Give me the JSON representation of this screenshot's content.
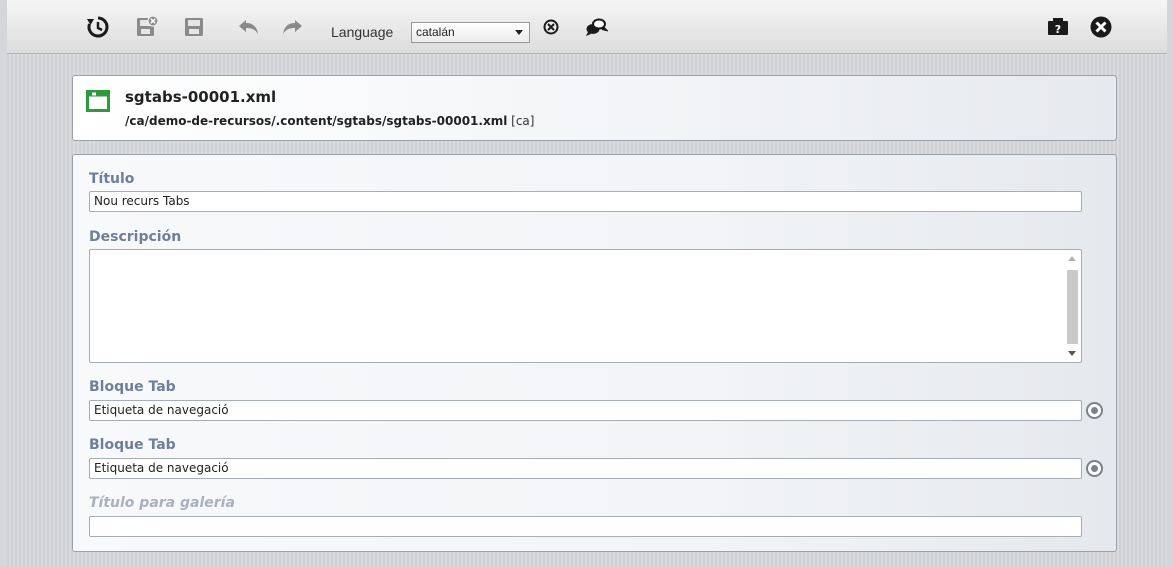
{
  "toolbar": {
    "icons": {
      "history": "history-icon",
      "save_exit": "save-exit-icon",
      "save": "save-icon",
      "undo": "undo-icon",
      "redo": "redo-icon",
      "delete_locale": "delete-locale-icon",
      "compare_locales": "compare-locales-icon",
      "help": "help-icon",
      "close": "close-icon"
    },
    "language_label": "Language",
    "language_value": "catalán"
  },
  "header": {
    "title": "sgtabs-00001.xml",
    "path": "/ca/demo-de-recursos/.content/sgtabs/sgtabs-00001.xml",
    "locale": "[ca]"
  },
  "form": {
    "titulo_label": "Título",
    "titulo_value": "Nou recurs Tabs",
    "descripcion_label": "Descripción",
    "descripcion_value": "",
    "bloque1_label": "Bloque Tab",
    "bloque1_value": "Etiqueta de navegació",
    "bloque2_label": "Bloque Tab",
    "bloque2_value": "Etiqueta de navegació",
    "galeria_label": "Título para galería",
    "galeria_value": ""
  },
  "colors": {
    "label": "#6e7f9c",
    "label_muted": "#a9b1bd",
    "file_icon": "#2e9a3e"
  }
}
